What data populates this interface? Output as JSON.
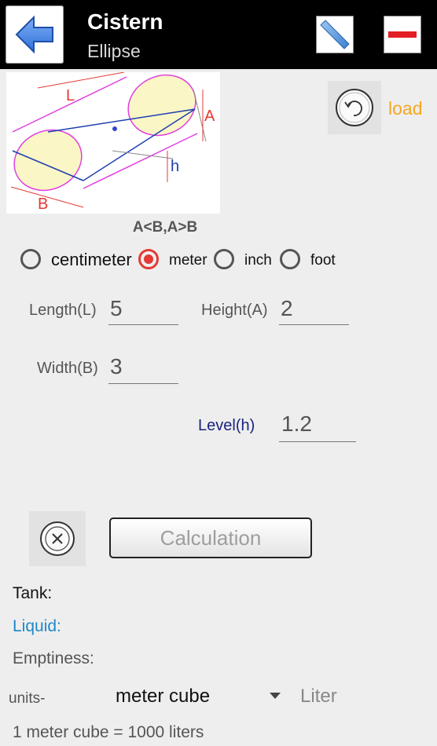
{
  "header": {
    "title": "Cistern",
    "subtitle": "Ellipse"
  },
  "diagram": {
    "label_L": "L",
    "label_A": "A",
    "label_B": "B",
    "label_h": "h",
    "condition": "A<B,A>B"
  },
  "load": {
    "label": "load"
  },
  "units": {
    "options": [
      "centimeter",
      "meter",
      "inch",
      "foot"
    ],
    "selected": "meter"
  },
  "fields": {
    "length_label": "Length(L)",
    "length_value": "5",
    "height_label": "Height(A)",
    "height_value": "2",
    "width_label": "Width(B)",
    "width_value": "3",
    "level_label": "Level(h)",
    "level_value": "1.2"
  },
  "actions": {
    "calculation_label": "Calculation"
  },
  "results": {
    "tank_label": "Tank:",
    "liquid_label": "Liquid:",
    "emptiness_label": "Emptiness:",
    "units_label": "units-",
    "units_selected": "meter cube",
    "liter_label": "Liter",
    "conversion_note": "1 meter cube = 1000 liters"
  },
  "colors": {
    "header_bg": "#000000",
    "accent_red": "#e53935",
    "load_orange": "#f5a623",
    "liquid_blue": "#1e88c8",
    "level_navy": "#1a237e"
  }
}
